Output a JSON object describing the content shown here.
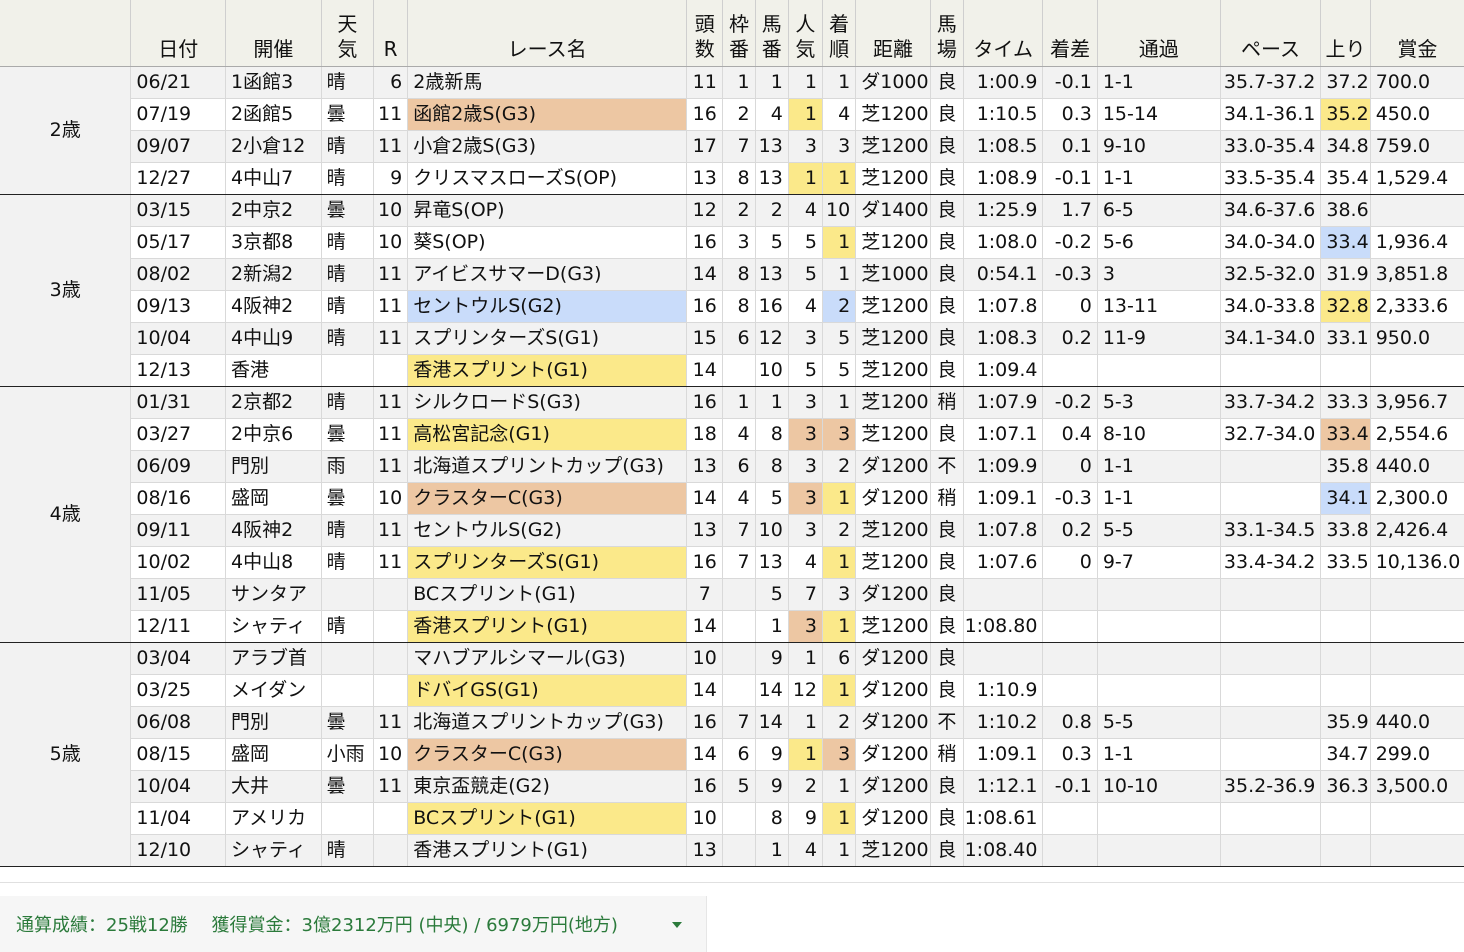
{
  "headers": {
    "date": "日付",
    "venue": "開催",
    "weather": "天\n気",
    "r": "R",
    "race": "レース名",
    "runners": "頭\n数",
    "frame": "枠\n番",
    "horseno": "馬\n番",
    "pop": "人\n気",
    "finish": "着\n順",
    "dist": "距離",
    "track": "馬\n場",
    "time": "タイム",
    "margin": "着差",
    "passing": "通過",
    "pace": "ペース",
    "last": "上り",
    "prize": "賞金"
  },
  "groups": [
    {
      "age": "2歳",
      "rows": [
        {
          "date": "06/21",
          "venue": "1函館3",
          "weather": "晴",
          "r": "6",
          "race": "2歳新馬",
          "runners": "11",
          "frame": "1",
          "horseno": "1",
          "pop": "1",
          "finish": "1",
          "dist": "ダ1000",
          "track": "良",
          "time": "1:00.9",
          "margin": "-0.1",
          "passing": "1-1",
          "pace": "35.7-37.2",
          "last": "37.2",
          "prize": "700.0",
          "raceColor": "",
          "popColor": "ye",
          "finColor": "ye",
          "lastColor": ""
        },
        {
          "date": "07/19",
          "venue": "2函館5",
          "weather": "曇",
          "r": "11",
          "race": "函館2歳S(G3)",
          "runners": "16",
          "frame": "2",
          "horseno": "4",
          "pop": "1",
          "finish": "4",
          "dist": "芝1200",
          "track": "良",
          "time": "1:10.5",
          "margin": "0.3",
          "passing": "15-14",
          "pace": "34.1-36.1",
          "last": "35.2",
          "prize": "450.0",
          "raceColor": "or",
          "popColor": "ye",
          "finColor": "",
          "lastColor": "ye"
        },
        {
          "date": "09/07",
          "venue": "2小倉12",
          "weather": "晴",
          "r": "11",
          "race": "小倉2歳S(G3)",
          "runners": "17",
          "frame": "7",
          "horseno": "13",
          "pop": "3",
          "finish": "3",
          "dist": "芝1200",
          "track": "良",
          "time": "1:08.5",
          "margin": "0.1",
          "passing": "9-10",
          "pace": "33.0-35.4",
          "last": "34.8",
          "prize": "759.0",
          "raceColor": "or",
          "popColor": "or",
          "finColor": "or",
          "lastColor": "bl"
        },
        {
          "date": "12/27",
          "venue": "4中山7",
          "weather": "晴",
          "r": "9",
          "race": "クリスマスローズS(OP)",
          "runners": "13",
          "frame": "8",
          "horseno": "13",
          "pop": "1",
          "finish": "1",
          "dist": "芝1200",
          "track": "良",
          "time": "1:08.9",
          "margin": "-0.1",
          "passing": "1-1",
          "pace": "33.5-35.4",
          "last": "35.4",
          "prize": "1,529.4",
          "raceColor": "",
          "popColor": "ye",
          "finColor": "ye",
          "lastColor": ""
        }
      ]
    },
    {
      "age": "3歳",
      "rows": [
        {
          "date": "03/15",
          "venue": "2中京2",
          "weather": "曇",
          "r": "10",
          "race": "昇竜S(OP)",
          "runners": "12",
          "frame": "2",
          "horseno": "2",
          "pop": "4",
          "finish": "10",
          "dist": "ダ1400",
          "track": "良",
          "time": "1:25.9",
          "margin": "1.7",
          "passing": "6-5",
          "pace": "34.6-37.6",
          "last": "38.6",
          "prize": "",
          "raceColor": "",
          "popColor": "",
          "finColor": "",
          "lastColor": ""
        },
        {
          "date": "05/17",
          "venue": "3京都8",
          "weather": "晴",
          "r": "10",
          "race": "葵S(OP)",
          "runners": "16",
          "frame": "3",
          "horseno": "5",
          "pop": "5",
          "finish": "1",
          "dist": "芝1200",
          "track": "良",
          "time": "1:08.0",
          "margin": "-0.2",
          "passing": "5-6",
          "pace": "34.0-34.0",
          "last": "33.4",
          "prize": "1,936.4",
          "raceColor": "",
          "popColor": "",
          "finColor": "ye",
          "lastColor": "bl"
        },
        {
          "date": "08/02",
          "venue": "2新潟2",
          "weather": "晴",
          "r": "11",
          "race": "アイビスサマーD(G3)",
          "runners": "14",
          "frame": "8",
          "horseno": "13",
          "pop": "5",
          "finish": "1",
          "dist": "芝1000",
          "track": "良",
          "time": "0:54.1",
          "margin": "-0.3",
          "passing": "3",
          "pace": "32.5-32.0",
          "last": "31.9",
          "prize": "3,851.8",
          "raceColor": "or",
          "popColor": "",
          "finColor": "ye",
          "lastColor": "bl"
        },
        {
          "date": "09/13",
          "venue": "4阪神2",
          "weather": "晴",
          "r": "11",
          "race": "セントウルS(G2)",
          "runners": "16",
          "frame": "8",
          "horseno": "16",
          "pop": "4",
          "finish": "2",
          "dist": "芝1200",
          "track": "良",
          "time": "1:07.8",
          "margin": "0",
          "passing": "13-11",
          "pace": "34.0-33.8",
          "last": "32.8",
          "prize": "2,333.6",
          "raceColor": "bl",
          "popColor": "",
          "finColor": "bl",
          "lastColor": "ye"
        },
        {
          "date": "10/04",
          "venue": "4中山9",
          "weather": "晴",
          "r": "11",
          "race": "スプリンターズS(G1)",
          "runners": "15",
          "frame": "6",
          "horseno": "12",
          "pop": "3",
          "finish": "5",
          "dist": "芝1200",
          "track": "良",
          "time": "1:08.3",
          "margin": "0.2",
          "passing": "11-9",
          "pace": "34.1-34.0",
          "last": "33.1",
          "prize": "950.0",
          "raceColor": "ye",
          "popColor": "or",
          "finColor": "",
          "lastColor": "bl"
        },
        {
          "date": "12/13",
          "venue": "香港",
          "weather": "",
          "r": "",
          "race": "香港スプリント(G1)",
          "runners": "14",
          "frame": "",
          "horseno": "10",
          "pop": "5",
          "finish": "5",
          "dist": "芝1200",
          "track": "良",
          "time": "1:09.4",
          "margin": "",
          "passing": "",
          "pace": "",
          "last": "",
          "prize": "",
          "raceColor": "ye",
          "popColor": "",
          "finColor": "",
          "lastColor": ""
        }
      ]
    },
    {
      "age": "4歳",
      "rows": [
        {
          "date": "01/31",
          "venue": "2京都2",
          "weather": "晴",
          "r": "11",
          "race": "シルクロードS(G3)",
          "runners": "16",
          "frame": "1",
          "horseno": "1",
          "pop": "3",
          "finish": "1",
          "dist": "芝1200",
          "track": "稍",
          "time": "1:07.9",
          "margin": "-0.2",
          "passing": "5-3",
          "pace": "33.7-34.2",
          "last": "33.3",
          "prize": "3,956.7",
          "raceColor": "or",
          "popColor": "or",
          "finColor": "ye",
          "lastColor": "bl"
        },
        {
          "date": "03/27",
          "venue": "2中京6",
          "weather": "曇",
          "r": "11",
          "race": "高松宮記念(G1)",
          "runners": "18",
          "frame": "4",
          "horseno": "8",
          "pop": "3",
          "finish": "3",
          "dist": "芝1200",
          "track": "良",
          "time": "1:07.1",
          "margin": "0.4",
          "passing": "8-10",
          "pace": "32.7-34.0",
          "last": "33.4",
          "prize": "2,554.6",
          "raceColor": "ye",
          "popColor": "or",
          "finColor": "or",
          "lastColor": "or"
        },
        {
          "date": "06/09",
          "venue": "門別",
          "weather": "雨",
          "r": "11",
          "race": "北海道スプリントカップ(G3)",
          "runners": "13",
          "frame": "6",
          "horseno": "8",
          "pop": "3",
          "finish": "2",
          "dist": "ダ1200",
          "track": "不",
          "time": "1:09.9",
          "margin": "0",
          "passing": "1-1",
          "pace": "",
          "last": "35.8",
          "prize": "440.0",
          "raceColor": "or",
          "popColor": "or",
          "finColor": "bl",
          "lastColor": "bl"
        },
        {
          "date": "08/16",
          "venue": "盛岡",
          "weather": "曇",
          "r": "10",
          "race": "クラスターC(G3)",
          "runners": "14",
          "frame": "4",
          "horseno": "5",
          "pop": "3",
          "finish": "1",
          "dist": "ダ1200",
          "track": "稍",
          "time": "1:09.1",
          "margin": "-0.3",
          "passing": "1-1",
          "pace": "",
          "last": "34.1",
          "prize": "2,300.0",
          "raceColor": "or",
          "popColor": "or",
          "finColor": "ye",
          "lastColor": "bl"
        },
        {
          "date": "09/11",
          "venue": "4阪神2",
          "weather": "晴",
          "r": "11",
          "race": "セントウルS(G2)",
          "runners": "13",
          "frame": "7",
          "horseno": "10",
          "pop": "3",
          "finish": "2",
          "dist": "芝1200",
          "track": "良",
          "time": "1:07.8",
          "margin": "0.2",
          "passing": "5-5",
          "pace": "33.1-34.5",
          "last": "33.8",
          "prize": "2,426.4",
          "raceColor": "bl",
          "popColor": "or",
          "finColor": "bl",
          "lastColor": ""
        },
        {
          "date": "10/02",
          "venue": "4中山8",
          "weather": "晴",
          "r": "11",
          "race": "スプリンターズS(G1)",
          "runners": "16",
          "frame": "7",
          "horseno": "13",
          "pop": "4",
          "finish": "1",
          "dist": "芝1200",
          "track": "良",
          "time": "1:07.6",
          "margin": "0",
          "passing": "9-7",
          "pace": "33.4-34.2",
          "last": "33.5",
          "prize": "10,136.0",
          "raceColor": "ye",
          "popColor": "",
          "finColor": "ye",
          "lastColor": ""
        },
        {
          "date": "11/05",
          "venue": "サンタア",
          "weather": "",
          "r": "",
          "race": "BCスプリント(G1)",
          "runners": "7",
          "frame": "",
          "horseno": "5",
          "pop": "7",
          "finish": "3",
          "dist": "ダ1200",
          "track": "良",
          "time": "",
          "margin": "",
          "passing": "",
          "pace": "",
          "last": "",
          "prize": "",
          "raceColor": "ye",
          "popColor": "",
          "finColor": "or",
          "lastColor": ""
        },
        {
          "date": "12/11",
          "venue": "シャティ",
          "weather": "晴",
          "r": "",
          "race": "香港スプリント(G1)",
          "runners": "14",
          "frame": "",
          "horseno": "1",
          "pop": "3",
          "finish": "1",
          "dist": "芝1200",
          "track": "良",
          "time": "1:08.80",
          "margin": "",
          "passing": "",
          "pace": "",
          "last": "",
          "prize": "",
          "raceColor": "ye",
          "popColor": "or",
          "finColor": "ye",
          "lastColor": ""
        }
      ]
    },
    {
      "age": "5歳",
      "rows": [
        {
          "date": "03/04",
          "venue": "アラブ首",
          "weather": "",
          "r": "",
          "race": "マハブアルシマール(G3)",
          "runners": "10",
          "frame": "",
          "horseno": "9",
          "pop": "1",
          "finish": "6",
          "dist": "ダ1200",
          "track": "良",
          "time": "",
          "margin": "",
          "passing": "",
          "pace": "",
          "last": "",
          "prize": "",
          "raceColor": "or",
          "popColor": "ye",
          "finColor": "",
          "lastColor": ""
        },
        {
          "date": "03/25",
          "venue": "メイダン",
          "weather": "",
          "r": "",
          "race": "ドバイGS(G1)",
          "runners": "14",
          "frame": "",
          "horseno": "14",
          "pop": "12",
          "finish": "1",
          "dist": "ダ1200",
          "track": "良",
          "time": "1:10.9",
          "margin": "",
          "passing": "",
          "pace": "",
          "last": "",
          "prize": "",
          "raceColor": "ye",
          "popColor": "",
          "finColor": "ye",
          "lastColor": ""
        },
        {
          "date": "06/08",
          "venue": "門別",
          "weather": "曇",
          "r": "11",
          "race": "北海道スプリントカップ(G3)",
          "runners": "16",
          "frame": "7",
          "horseno": "14",
          "pop": "1",
          "finish": "2",
          "dist": "ダ1200",
          "track": "不",
          "time": "1:10.2",
          "margin": "0.8",
          "passing": "5-5",
          "pace": "",
          "last": "35.9",
          "prize": "440.0",
          "raceColor": "or",
          "popColor": "ye",
          "finColor": "bl",
          "lastColor": ""
        },
        {
          "date": "08/15",
          "venue": "盛岡",
          "weather": "小雨",
          "r": "10",
          "race": "クラスターC(G3)",
          "runners": "14",
          "frame": "6",
          "horseno": "9",
          "pop": "1",
          "finish": "3",
          "dist": "ダ1200",
          "track": "稍",
          "time": "1:09.1",
          "margin": "0.3",
          "passing": "1-1",
          "pace": "",
          "last": "34.7",
          "prize": "299.0",
          "raceColor": "or",
          "popColor": "ye",
          "finColor": "or",
          "lastColor": ""
        },
        {
          "date": "10/04",
          "venue": "大井",
          "weather": "曇",
          "r": "11",
          "race": "東京盃競走(G2)",
          "runners": "16",
          "frame": "5",
          "horseno": "9",
          "pop": "2",
          "finish": "1",
          "dist": "ダ1200",
          "track": "良",
          "time": "1:12.1",
          "margin": "-0.1",
          "passing": "10-10",
          "pace": "35.2-36.9",
          "last": "36.3",
          "prize": "3,500.0",
          "raceColor": "bl",
          "popColor": "bl",
          "finColor": "ye",
          "lastColor": "ye"
        },
        {
          "date": "11/04",
          "venue": "アメリカ",
          "weather": "",
          "r": "",
          "race": "BCスプリント(G1)",
          "runners": "10",
          "frame": "",
          "horseno": "8",
          "pop": "9",
          "finish": "1",
          "dist": "ダ1200",
          "track": "良",
          "time": "1:08.61",
          "margin": "",
          "passing": "",
          "pace": "",
          "last": "",
          "prize": "",
          "raceColor": "ye",
          "popColor": "",
          "finColor": "ye",
          "lastColor": ""
        },
        {
          "date": "12/10",
          "venue": "シャティ",
          "weather": "晴",
          "r": "",
          "race": "香港スプリント(G1)",
          "runners": "13",
          "frame": "",
          "horseno": "1",
          "pop": "4",
          "finish": "1",
          "dist": "芝1200",
          "track": "良",
          "time": "1:08.40",
          "margin": "",
          "passing": "",
          "pace": "",
          "last": "",
          "prize": "",
          "raceColor": "ye",
          "popColor": "",
          "finColor": "ye",
          "lastColor": ""
        }
      ]
    }
  ],
  "footer": {
    "record": "通算成績：25戦12勝",
    "earnings": "獲得賞金：3億2312万円 (中央) / 6979万円(地方)"
  },
  "colors": {
    "yellow": "#fbe98a",
    "orange": "#edc7a3",
    "blue": "#c9dcfa",
    "accent": "#2b7a3b"
  }
}
